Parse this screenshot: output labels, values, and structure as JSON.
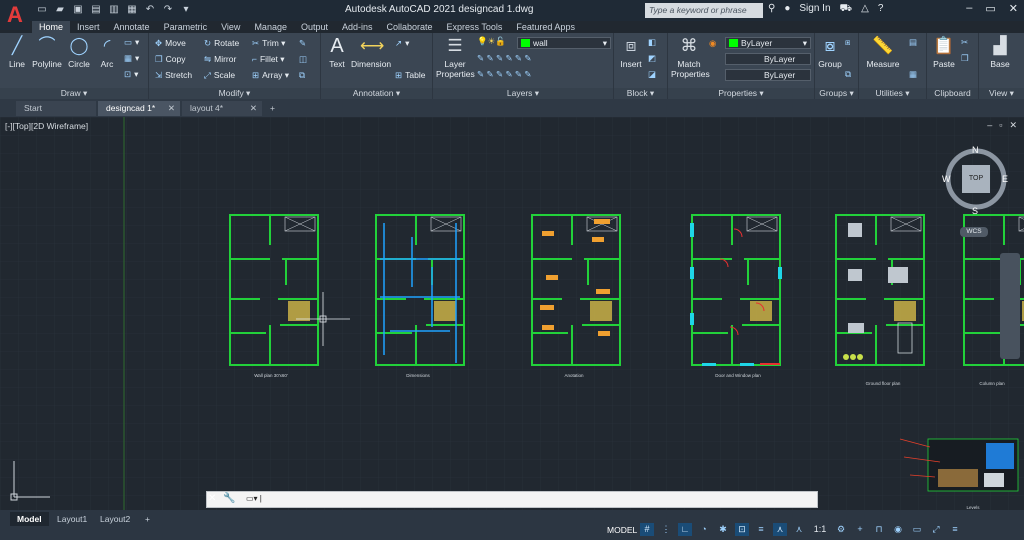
{
  "app": {
    "title": "Autodesk AutoCAD 2021    designcad 1.dwg",
    "search_placeholder": "Type a keyword or phrase",
    "signin": "Sign In"
  },
  "ribbon_tabs": [
    "Home",
    "Insert",
    "Annotate",
    "Parametric",
    "View",
    "Manage",
    "Output",
    "Add-ins",
    "Collaborate",
    "Express Tools",
    "Featured Apps"
  ],
  "active_ribbon_tab": "Home",
  "draw": {
    "title": "Draw ▾",
    "line": "Line",
    "polyline": "Polyline",
    "circle": "Circle",
    "arc": "Arc"
  },
  "modify": {
    "title": "Modify ▾",
    "move": "Move",
    "rotate": "Rotate",
    "trim": "Trim",
    "copy": "Copy",
    "mirror": "Mirror",
    "fillet": "Fillet",
    "stretch": "Stretch",
    "scale": "Scale",
    "array": "Array"
  },
  "annotation": {
    "title": "Annotation ▾",
    "text": "Text",
    "dimension": "Dimension",
    "table": "Table"
  },
  "layers": {
    "title": "Layers ▾",
    "layer_properties": "Layer Properties",
    "current_layer": "wall",
    "layer_color": "#00ff00"
  },
  "block": {
    "title": "Block ▾",
    "insert": "Insert"
  },
  "properties": {
    "title": "Properties ▾",
    "match": "Match Properties",
    "color": "ByLayer",
    "linetype": "ByLayer",
    "lineweight": "ByLayer"
  },
  "groups": {
    "title": "Groups ▾",
    "group": "Group"
  },
  "utilities": {
    "title": "Utilities ▾",
    "measure": "Measure"
  },
  "clipboard": {
    "title": "Clipboard",
    "paste": "Paste"
  },
  "view": {
    "title": "View ▾",
    "base": "Base"
  },
  "file_tabs": [
    "Start",
    "designcad 1*",
    "layout 4*"
  ],
  "active_file_tab": "designcad 1*",
  "viewport": {
    "label": "[-][Top][2D Wireframe]"
  },
  "viewcube": {
    "top": "TOP",
    "n": "N",
    "s": "S",
    "e": "E",
    "w": "W",
    "wcs": "WCS"
  },
  "plans": [
    {
      "label": "Wall plan  30'x60'"
    },
    {
      "label": "Dimensions"
    },
    {
      "label": "Anotation"
    },
    {
      "label": "Door and Window plan"
    },
    {
      "label": "Ground floor plan"
    },
    {
      "label": "Column plan"
    }
  ],
  "elevation_label": "Levels",
  "command_line": {
    "value": ""
  },
  "layout_tabs": [
    "Model",
    "Layout1",
    "Layout2"
  ],
  "active_layout_tab": "Model",
  "status": {
    "model": "MODEL",
    "scale": "1:1"
  }
}
